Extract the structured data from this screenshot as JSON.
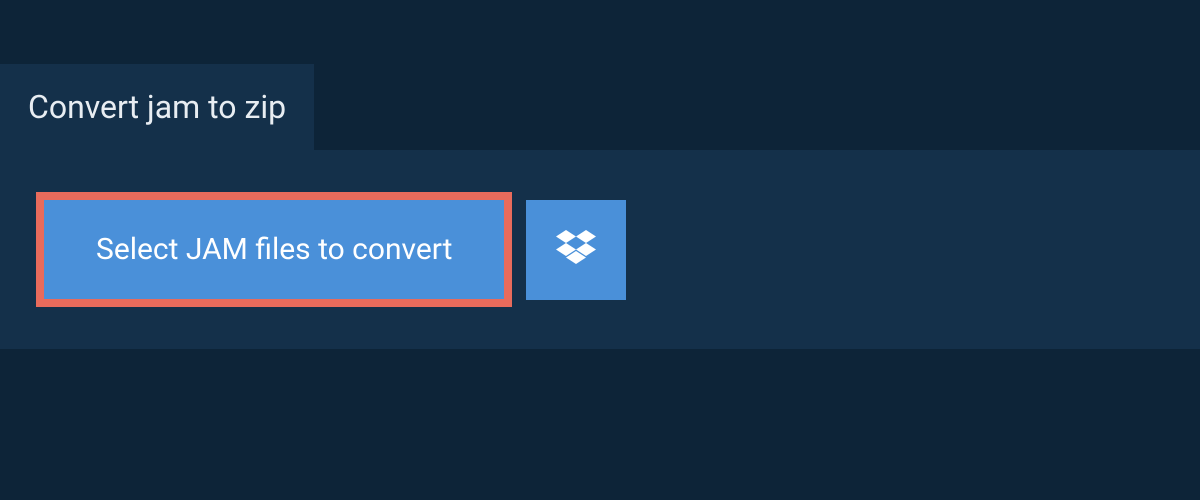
{
  "header": {
    "title": "Convert jam to zip"
  },
  "actions": {
    "select_files_label": "Select JAM files to convert"
  },
  "colors": {
    "background": "#0d2438",
    "panel": "#14304a",
    "button": "#4a90d9",
    "button_border": "#e86b5c",
    "text_light": "#e8edf2"
  }
}
